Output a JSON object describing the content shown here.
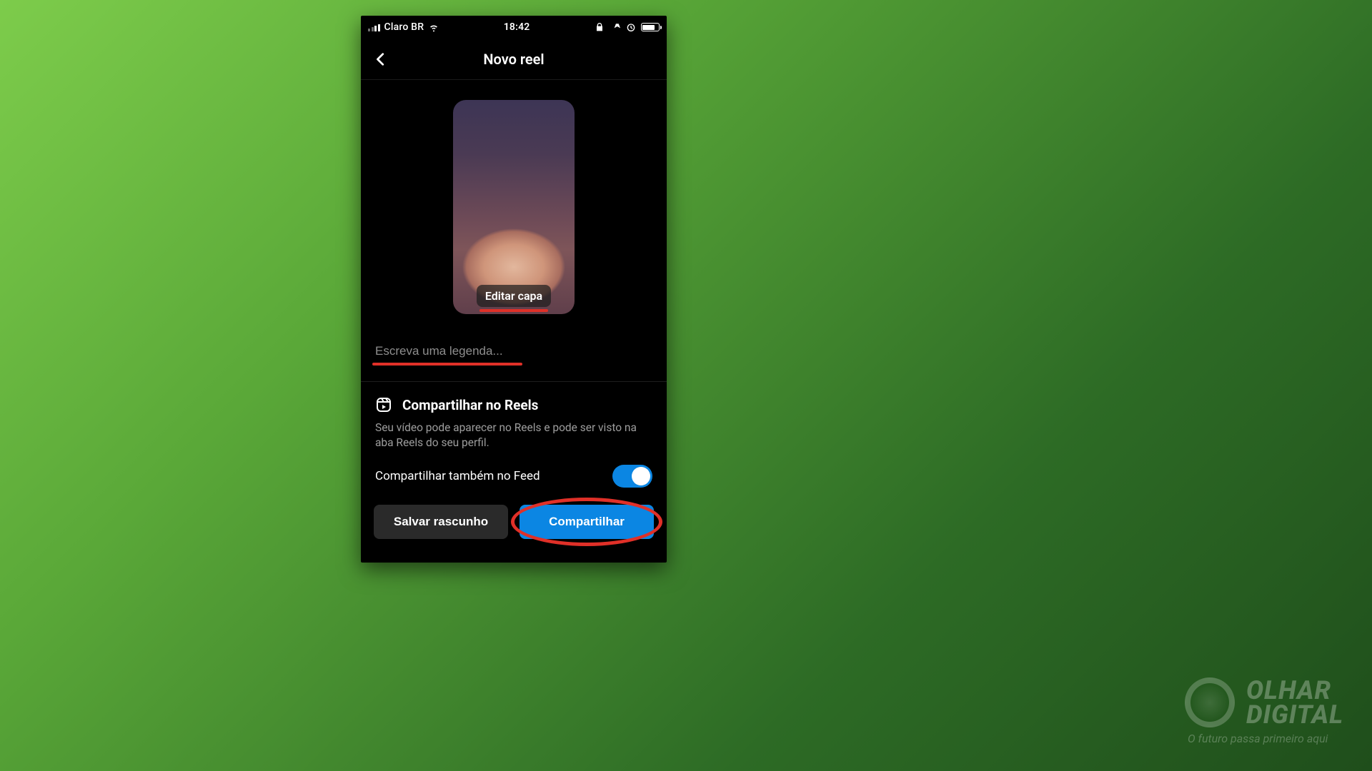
{
  "status_bar": {
    "carrier": "Claro BR",
    "time": "18:42"
  },
  "header": {
    "title": "Novo reel"
  },
  "cover": {
    "edit_label": "Editar capa"
  },
  "caption": {
    "placeholder": "Escreva uma legenda..."
  },
  "share": {
    "title": "Compartilhar no Reels",
    "description": "Seu vídeo pode aparecer no Reels e pode ser visto na aba Reels do seu perfil.",
    "feed_label": "Compartilhar também no Feed",
    "feed_toggle_on": true
  },
  "buttons": {
    "draft": "Salvar rascunho",
    "share": "Compartilhar"
  },
  "annotations": {
    "highlight_color": "#e03028"
  },
  "brand": {
    "name_line1": "OLHAR",
    "name_line2": "DIGITAL",
    "tagline": "O futuro passa primeiro aqui"
  }
}
